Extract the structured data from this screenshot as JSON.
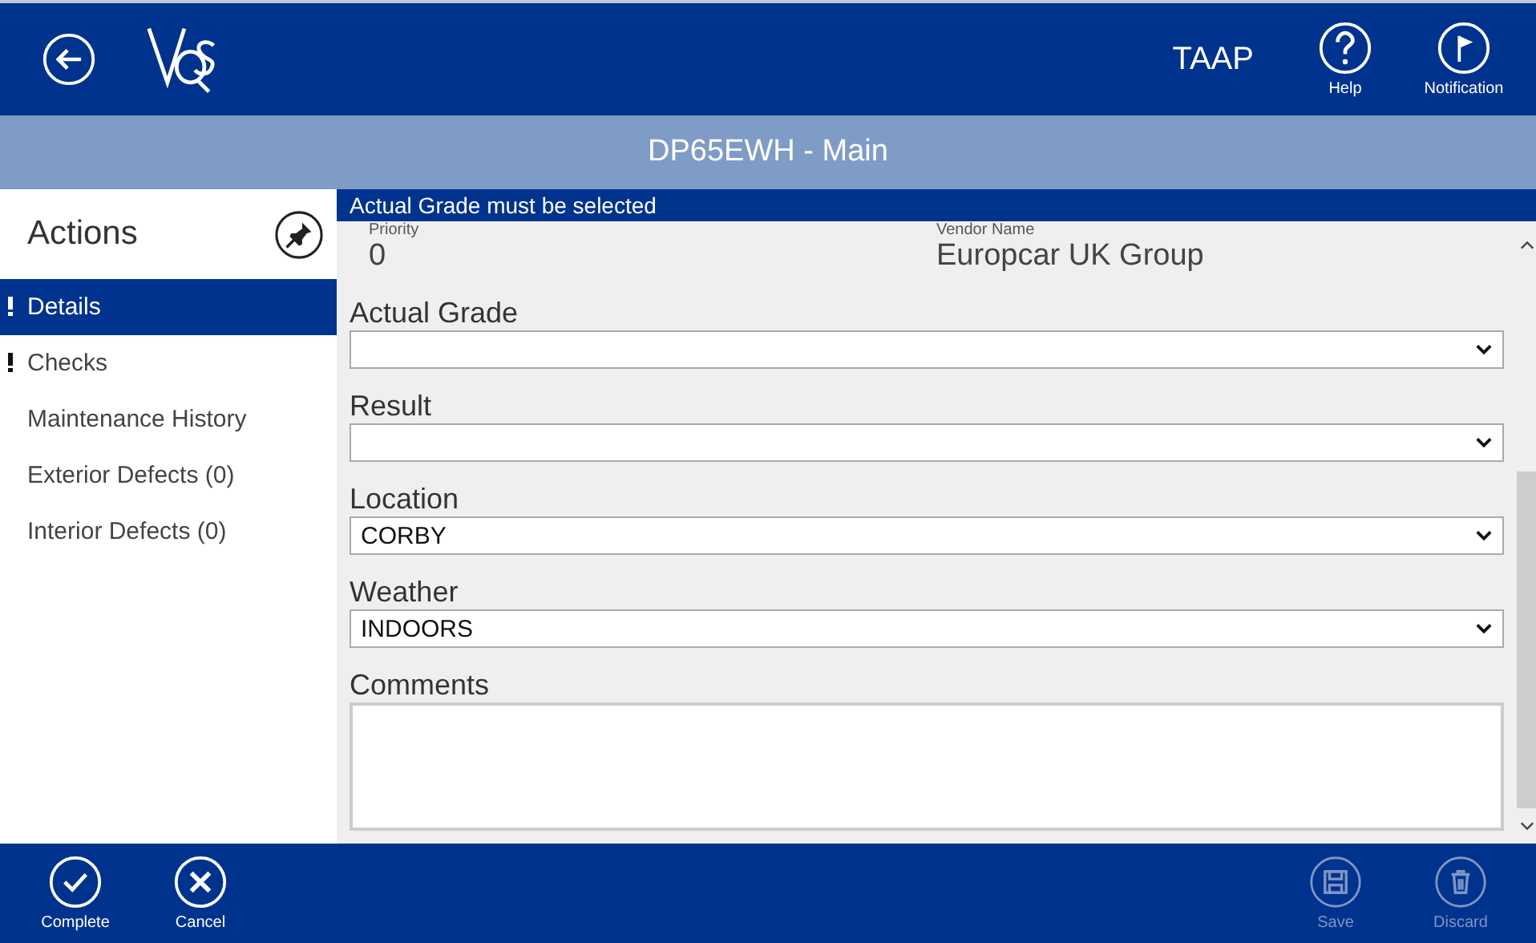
{
  "header": {
    "app_name": "TAAP",
    "buttons": [
      {
        "label": "Help",
        "kind": "help"
      },
      {
        "label": "Notification",
        "kind": "flag"
      }
    ]
  },
  "title_bar": {
    "title": "DP65EWH - Main"
  },
  "sidebar": {
    "title": "Actions",
    "items": [
      {
        "label": "Details",
        "selected": true,
        "warning": true
      },
      {
        "label": "Checks",
        "selected": false,
        "warning": true
      },
      {
        "label": "Maintenance History",
        "selected": false,
        "warning": false
      },
      {
        "label": "Exterior Defects (0)",
        "selected": false,
        "warning": false
      },
      {
        "label": "Interior Defects (0)",
        "selected": false,
        "warning": false
      }
    ]
  },
  "banner": "Actual Grade must be selected",
  "summary": [
    {
      "label": "Priority",
      "value": "0"
    },
    {
      "label": "Vendor Name",
      "value": "Europcar UK Group"
    }
  ],
  "fields": [
    {
      "kind": "select",
      "label": "Actual Grade"
    },
    {
      "kind": "select",
      "label": "Result"
    },
    {
      "kind": "select",
      "label": "Location",
      "value": "CORBY"
    },
    {
      "kind": "select",
      "label": "Weather",
      "value": "INDOORS"
    },
    {
      "kind": "textarea",
      "label": "Comments"
    }
  ],
  "app_bar": [
    {
      "label": "Complete",
      "kind": "check",
      "disabled": false
    },
    {
      "label": "Cancel",
      "kind": "cancel",
      "disabled": false
    },
    {
      "label": "Save",
      "kind": "save",
      "disabled": true
    },
    {
      "label": "Discard",
      "kind": "trash",
      "disabled": true
    }
  ]
}
